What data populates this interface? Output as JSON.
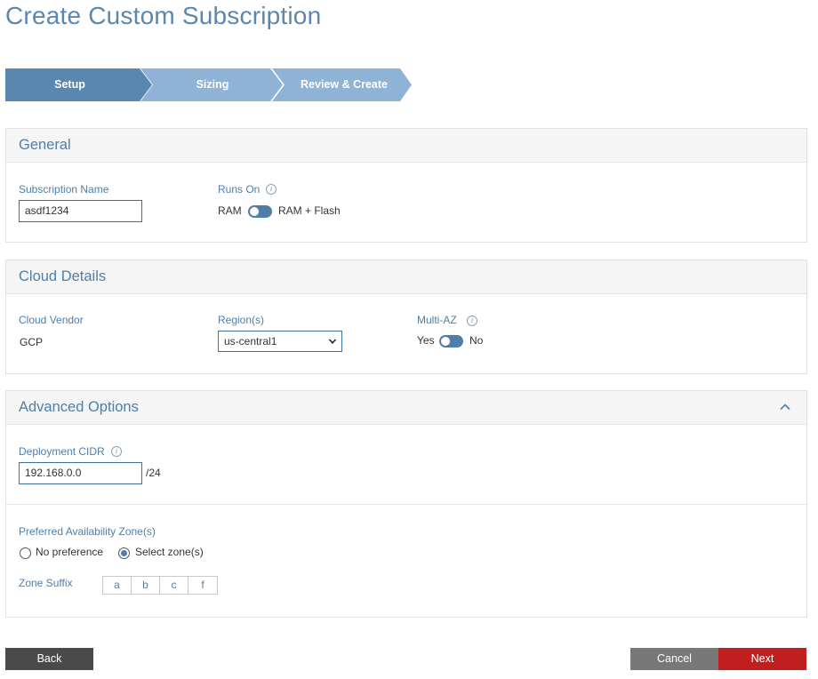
{
  "page": {
    "title": "Create Custom Subscription"
  },
  "wizard": {
    "steps": [
      {
        "label": "Setup",
        "color": "#5a87b0"
      },
      {
        "label": "Sizing",
        "color": "#8fb3d6"
      },
      {
        "label": "Review & Create",
        "color": "#8fb3d6"
      }
    ],
    "active_step": "Setup"
  },
  "general": {
    "heading": "General",
    "subscription_name_label": "Subscription Name",
    "subscription_name_value": "asdf1234",
    "runs_on_label": "Runs On",
    "runs_on_left": "RAM",
    "runs_on_right": "RAM + Flash"
  },
  "cloud": {
    "heading": "Cloud Details",
    "vendor_label": "Cloud Vendor",
    "vendor_value": "GCP",
    "region_label": "Region(s)",
    "region_value": "us-central1",
    "multi_az_label": "Multi-AZ",
    "multi_az_left": "Yes",
    "multi_az_right": "No"
  },
  "advanced": {
    "heading": "Advanced Options",
    "cidr_label": "Deployment CIDR",
    "cidr_value": "192.168.0.0",
    "cidr_suffix": "/24",
    "preferred_az_label": "Preferred Availability Zone(s)",
    "options": [
      "No preference",
      "Select zone(s)"
    ],
    "selected_option": "Select zone(s)",
    "zone_suffix_label": "Zone Suffix",
    "zones": [
      "a",
      "b",
      "c",
      "f"
    ]
  },
  "footer": {
    "back_label": "Back",
    "cancel_label": "Cancel",
    "next_label": "Next"
  },
  "icons": {
    "info": "info-icon",
    "collapse": "chevron-up-icon",
    "dropdown": "chevron-down-icon"
  },
  "colors": {
    "accent": "#4f7fa8",
    "next_button": "#c11f1f",
    "cancel_button": "#787878",
    "back_button": "#4a4a4a"
  }
}
